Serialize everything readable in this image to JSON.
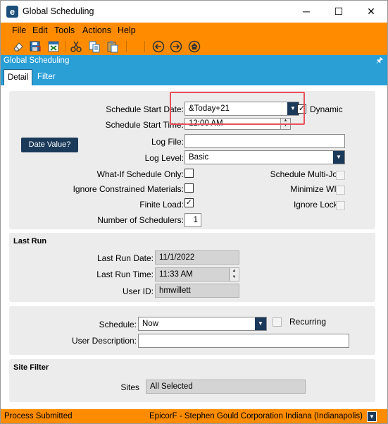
{
  "window": {
    "title": "Global Scheduling",
    "app_icon_glyph": "e",
    "minimize_glyph": "─",
    "maximize_glyph": "☐",
    "close_glyph": "✕"
  },
  "menu": [
    "File",
    "Edit",
    "Tools",
    "Actions",
    "Help"
  ],
  "toolbar": {
    "icons": [
      "eraser-icon",
      "save-icon",
      "export-icon",
      "cut-icon",
      "copy-icon",
      "paste-icon",
      "back-icon",
      "forward-icon",
      "home-icon"
    ]
  },
  "panel": {
    "title": "Global Scheduling",
    "pin_glyph": "🖈"
  },
  "tabs": [
    "Detail",
    "Filter"
  ],
  "detail": {
    "schedule_start_date_label": "Schedule Start Date:",
    "schedule_start_date_value": "&Today+21",
    "dynamic_label": "Dynamic",
    "dynamic_checked": true,
    "schedule_start_time_label": "Schedule Start Time:",
    "schedule_start_time_value": "12:00 AM",
    "date_value_button": "Date Value?",
    "log_file_label": "Log File:",
    "log_file_value": "",
    "log_level_label": "Log Level:",
    "log_level_value": "Basic",
    "what_if_label": "What-If Schedule Only:",
    "what_if_checked": false,
    "multi_job_label": "Schedule Multi-Job:",
    "multi_job_checked": false,
    "ignore_constrained_label": "Ignore Constrained Materials:",
    "ignore_constrained_checked": false,
    "minimize_wip_label": "Minimize WIP:",
    "minimize_wip_checked": false,
    "finite_load_label": "Finite Load:",
    "finite_load_checked": true,
    "ignore_locks_label": "Ignore Locks:",
    "ignore_locks_checked": false,
    "num_schedulers_label": "Number of Schedulers:",
    "num_schedulers_value": "1"
  },
  "last_run": {
    "title": "Last Run",
    "date_label": "Last Run Date:",
    "date_value": "11/1/2022",
    "time_label": "Last Run Time:",
    "time_value": "11:33 AM",
    "user_label": "User ID:",
    "user_value": "hmwillett"
  },
  "schedule_group": {
    "schedule_label": "Schedule:",
    "schedule_value": "Now",
    "recurring_label": "Recurring",
    "recurring_checked": false,
    "user_desc_label": "User Description:",
    "user_desc_value": ""
  },
  "site_filter": {
    "title": "Site Filter",
    "sites_label": "Sites",
    "sites_value": "All Selected"
  },
  "status": {
    "left": "Process Submitted",
    "right": "EpicorF - Stephen Gould Corporation  Indiana (Indianapolis)"
  },
  "colors": {
    "menu_bg": "#ff8c00",
    "panel_bg": "#2a9fd6",
    "dropdown_btn": "#1b3a5a",
    "highlight": "#e8505a"
  }
}
